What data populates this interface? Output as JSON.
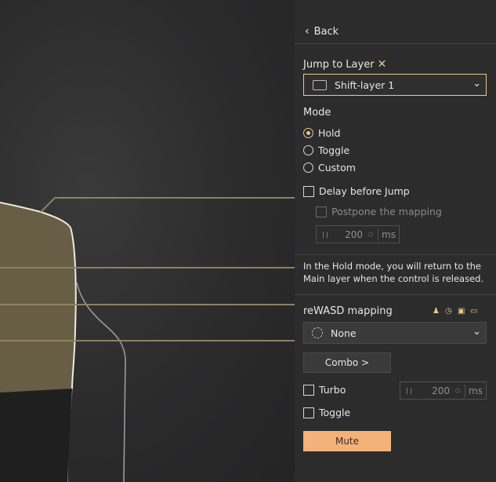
{
  "nav": {
    "back_label": "Back"
  },
  "jump": {
    "title": "Jump to Layer",
    "selected_layer": "Shift-layer 1"
  },
  "mode": {
    "title": "Mode",
    "options": [
      "Hold",
      "Toggle",
      "Custom"
    ],
    "selected": "Hold"
  },
  "delay": {
    "label": "Delay before Jump",
    "postpone_label": "Postpone the mapping",
    "value": "200",
    "unit": "ms"
  },
  "info_text": "In the Hold mode, you will return to the Main layer when the control is released.",
  "mapping": {
    "title": "reWASD mapping",
    "selected": "None",
    "icons": [
      "playstation-icon",
      "clock-icon",
      "gamepad-icon",
      "terminal-icon"
    ]
  },
  "combo_label": "Combo >",
  "turbo": {
    "label": "Turbo",
    "value": "200",
    "unit": "ms"
  },
  "toggle_label": "Toggle",
  "mute_label": "Mute",
  "colors": {
    "accent": "#e8c98a",
    "mute": "#f5b17a",
    "panel": "#2c2c2d"
  }
}
